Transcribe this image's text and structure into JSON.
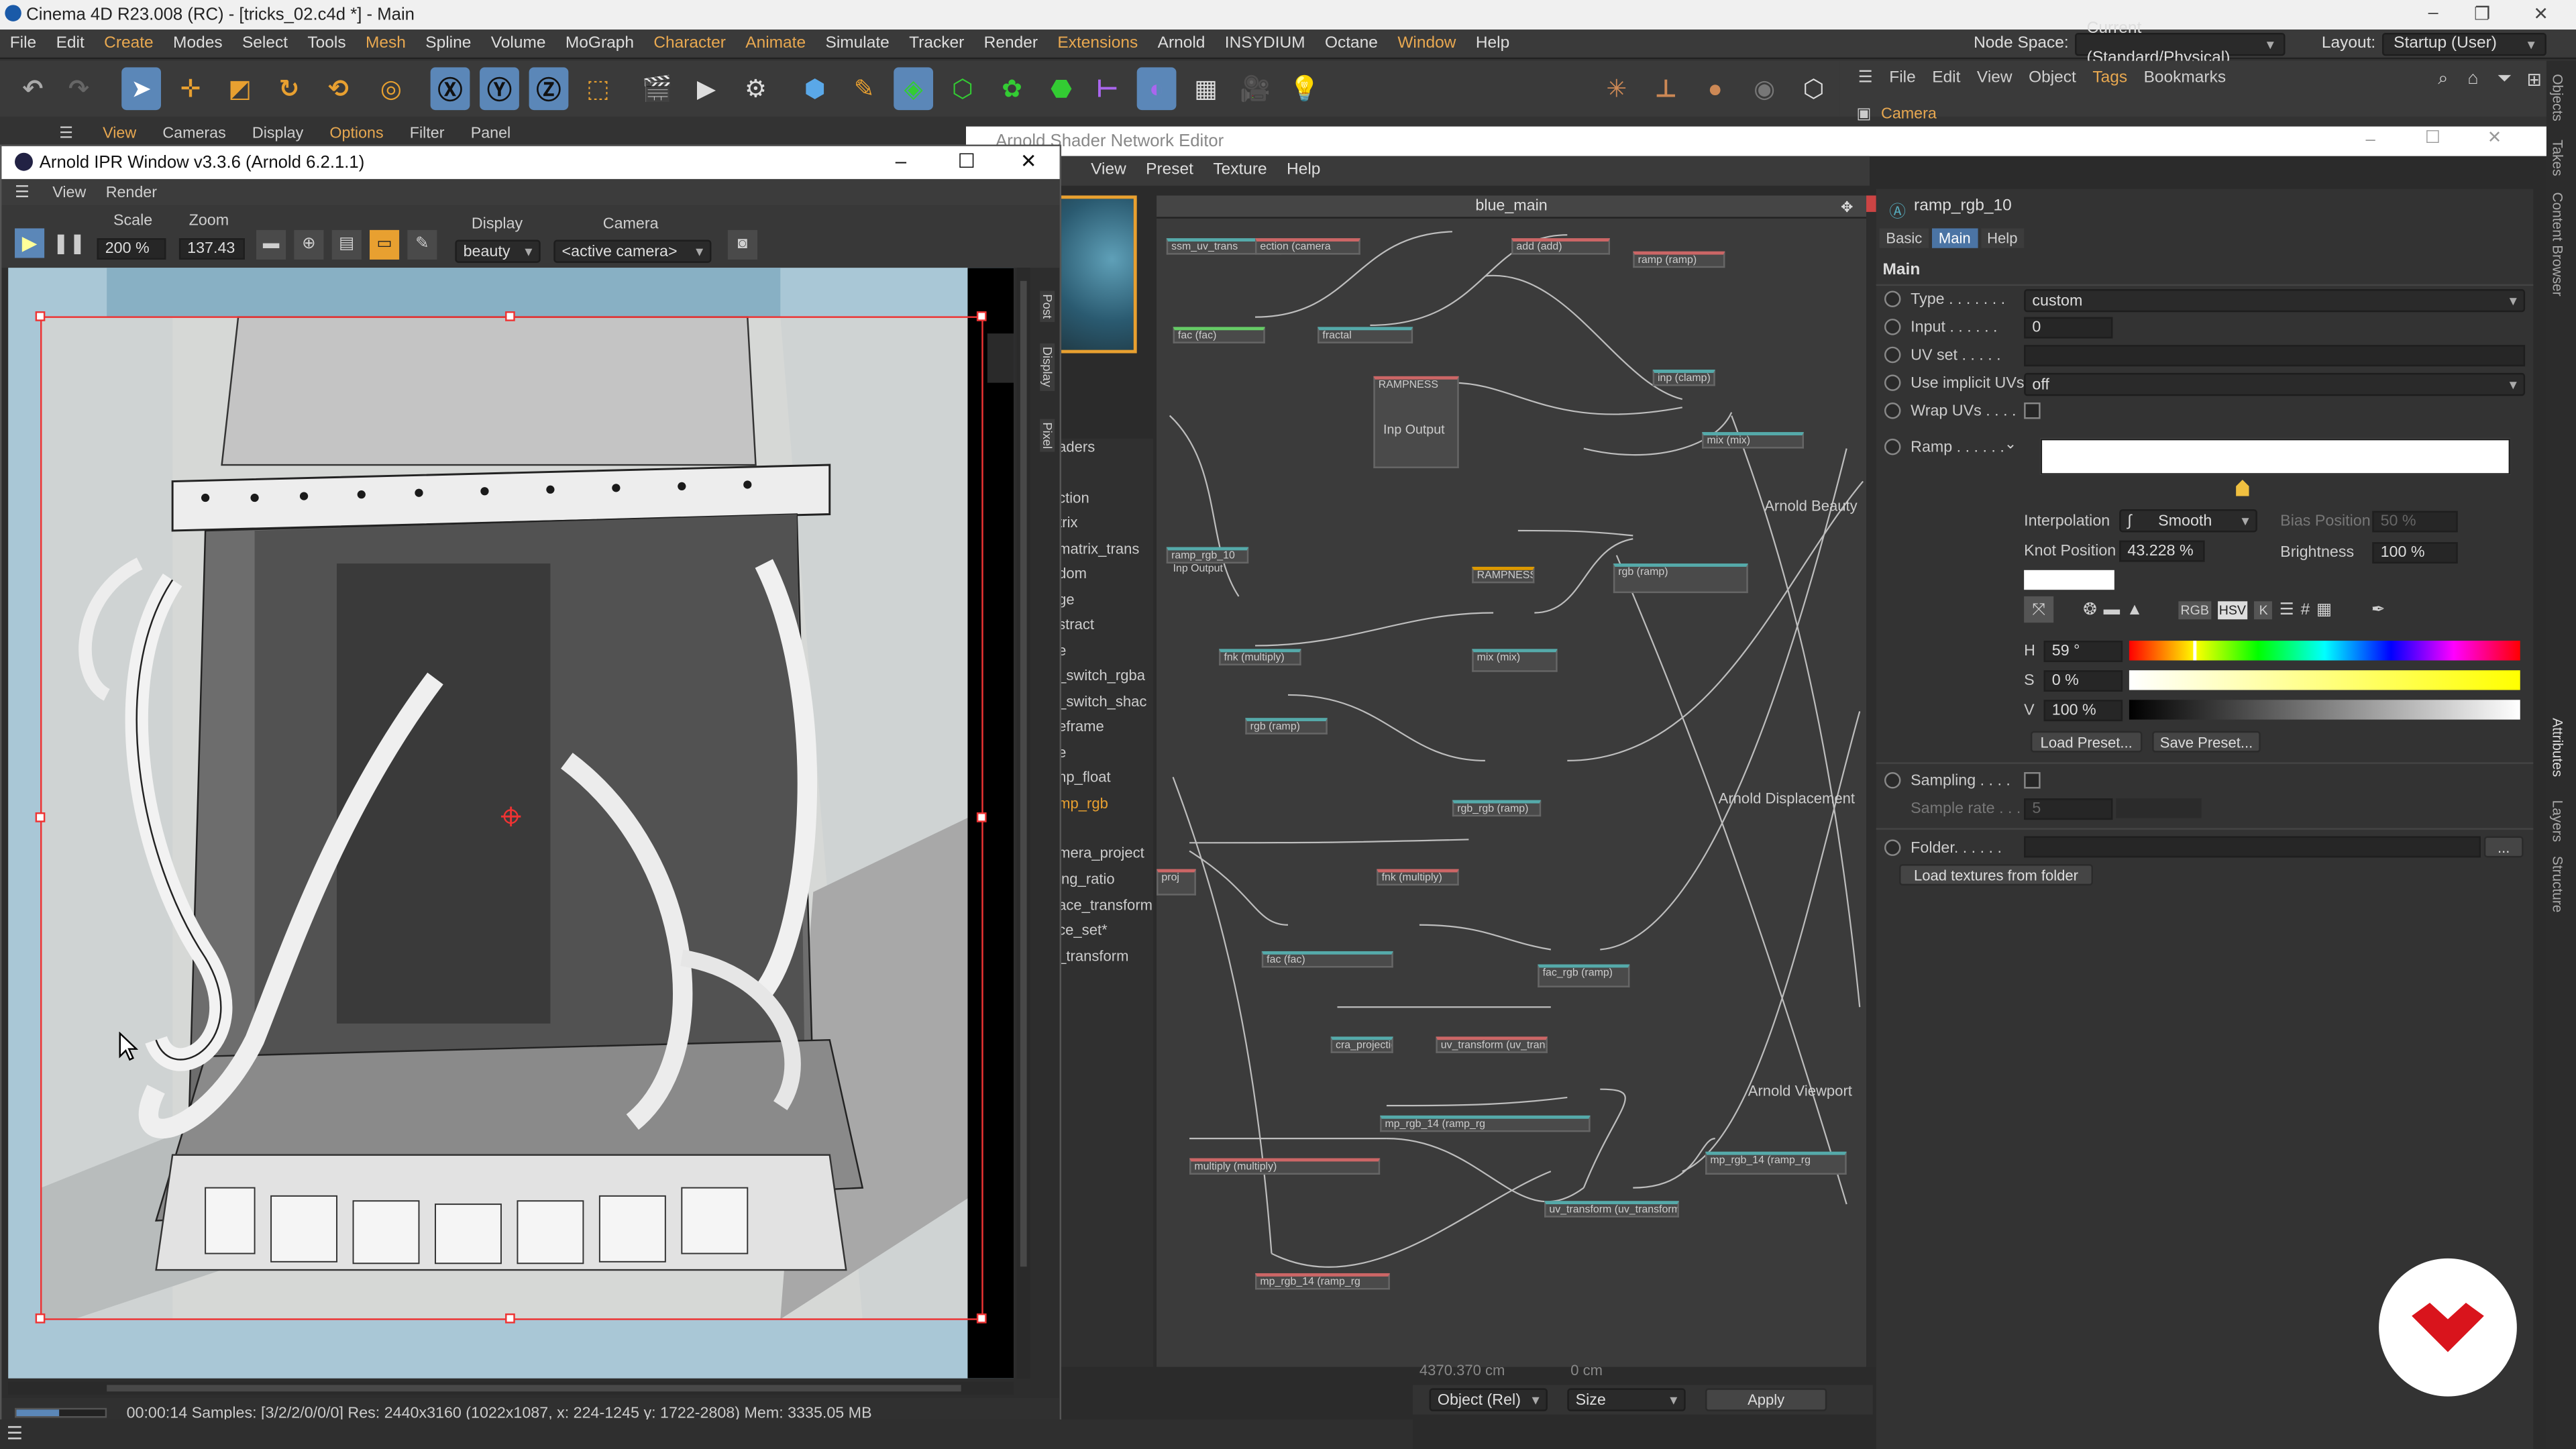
{
  "app_title": "Cinema 4D R23.008 (RC) - [tricks_02.c4d *] - Main",
  "menubar": {
    "items": [
      "File",
      "Edit",
      "Create",
      "Modes",
      "Select",
      "Tools",
      "Mesh",
      "Spline",
      "Volume",
      "MoGraph",
      "Character",
      "Animate",
      "Simulate",
      "Tracker",
      "Render",
      "Extensions",
      "Arnold",
      "INSYDIUM",
      "Octane",
      "Window",
      "Help"
    ],
    "node_space_label": "Node Space:",
    "node_space_value": "Current (Standard/Physical)",
    "layout_label": "Layout:",
    "layout_value": "Startup (User)"
  },
  "viewport_menu": [
    "View",
    "Cameras",
    "Display",
    "Options",
    "Filter",
    "Panel"
  ],
  "objects_menu": [
    "File",
    "Edit",
    "View",
    "Object",
    "Tags",
    "Bookmarks"
  ],
  "objects_item": "Camera",
  "ipr": {
    "title": "Arnold IPR Window v3.3.6 (Arnold 6.2.1.1)",
    "menu": [
      "View",
      "Render"
    ],
    "scale_label": "Scale",
    "scale_value": "200 %",
    "zoom_label": "Zoom",
    "zoom_value": "137.43",
    "display_label": "Display",
    "display_value": "beauty",
    "camera_label": "Camera",
    "camera_value": "<active camera>",
    "side_tabs": [
      "Post",
      "Display",
      "Pixel"
    ],
    "status": "00:00:14  Samples: [3/2/2/0/0/0]  Res: 2440x3160 (1022x1087, x: 224-1245 y: 1722-2808)  Mem: 3335.05 MB"
  },
  "shader_editor": {
    "title": "Arnold Shader Network Editor",
    "menu": [
      "View",
      "Preset",
      "Texture",
      "Help"
    ],
    "graph_title": "blue_main",
    "shader_list": [
      "aders",
      "ction",
      "trix",
      "matrix_trans",
      "dom",
      "ge",
      "stract",
      "e",
      "_switch_rgba",
      "_switch_shac",
      "eframe",
      "e",
      "np_float",
      "mp_rgb",
      "mera_project",
      "ing_ratio",
      "ace_transform",
      "ce_set*",
      "_transform"
    ],
    "output_labels": [
      "Arnold Beauty",
      "Arnold Displacement",
      "Arnold Viewport"
    ],
    "nodes": [
      "ssm_uv_trans",
      "ection (camera",
      "add (add)",
      "ramp (ramp)",
      "fac (fac)",
      "fractal",
      "inp (clamp)",
      "RAMPNESS",
      "Inp Output",
      "mix (mix)",
      "ramp_rgb_10",
      "Inp Output",
      "RAMPNESS",
      "rgb (ramp)",
      "fnk (multiply)",
      "mix (mix)",
      "rgb (ramp)",
      "proj",
      "rgb_rgb (ramp)",
      "fnk (multiply)",
      "fac (fac)",
      "fac_rgb (ramp)",
      "cra_projection (camera_project)",
      "uv_transform (uv_transform)",
      "mp_rgb_14 (ramp_rg",
      "multiply (multiply)",
      "mp_rgb_14 (ramp_rg"
    ]
  },
  "attributes": {
    "node_name": "ramp_rgb_10",
    "tabs": [
      "Basic",
      "Main",
      "Help"
    ],
    "section": "Main",
    "type_label": "Type . . . . . . .",
    "type_value": "custom",
    "input_label": "Input . . . . . .",
    "input_value": "0",
    "uvset_label": "UV set . . . . .",
    "implicit_label": "Use implicit UVs",
    "implicit_value": "off",
    "wrap_label": "Wrap UVs . . . .",
    "ramp_label": "Ramp . . . . . .",
    "interp_label": "Interpolation",
    "interp_value": "Smooth",
    "bias_label": "Bias Position",
    "bias_value": "50 %",
    "knot_label": "Knot Position",
    "knot_value": "43.228 %",
    "bright_label": "Brightness",
    "bright_value": "100 %",
    "h_label": "H",
    "h_value": "59 °",
    "s_label": "S",
    "s_value": "0 %",
    "v_label": "V",
    "v_value": "100 %",
    "load_preset": "Load Preset...",
    "save_preset": "Save Preset...",
    "sampling_label": "Sampling . . . .",
    "sample_rate_label": "Sample rate . . .",
    "sample_rate_value": "5",
    "folder_label": "Folder. . . . . .",
    "folder_btn": "...",
    "load_textures": "Load textures from folder",
    "color_modes": [
      "RGB",
      "HSV",
      "K"
    ]
  },
  "right_strip": [
    "Objects",
    "Takes",
    "Content Browser",
    "Attributes",
    "Layers",
    "Structure"
  ],
  "bottom": {
    "coord": "4370.370 cm",
    "coord2": "0 cm",
    "mode_value": "Object (Rel)",
    "size_value": "Size",
    "apply": "Apply"
  }
}
